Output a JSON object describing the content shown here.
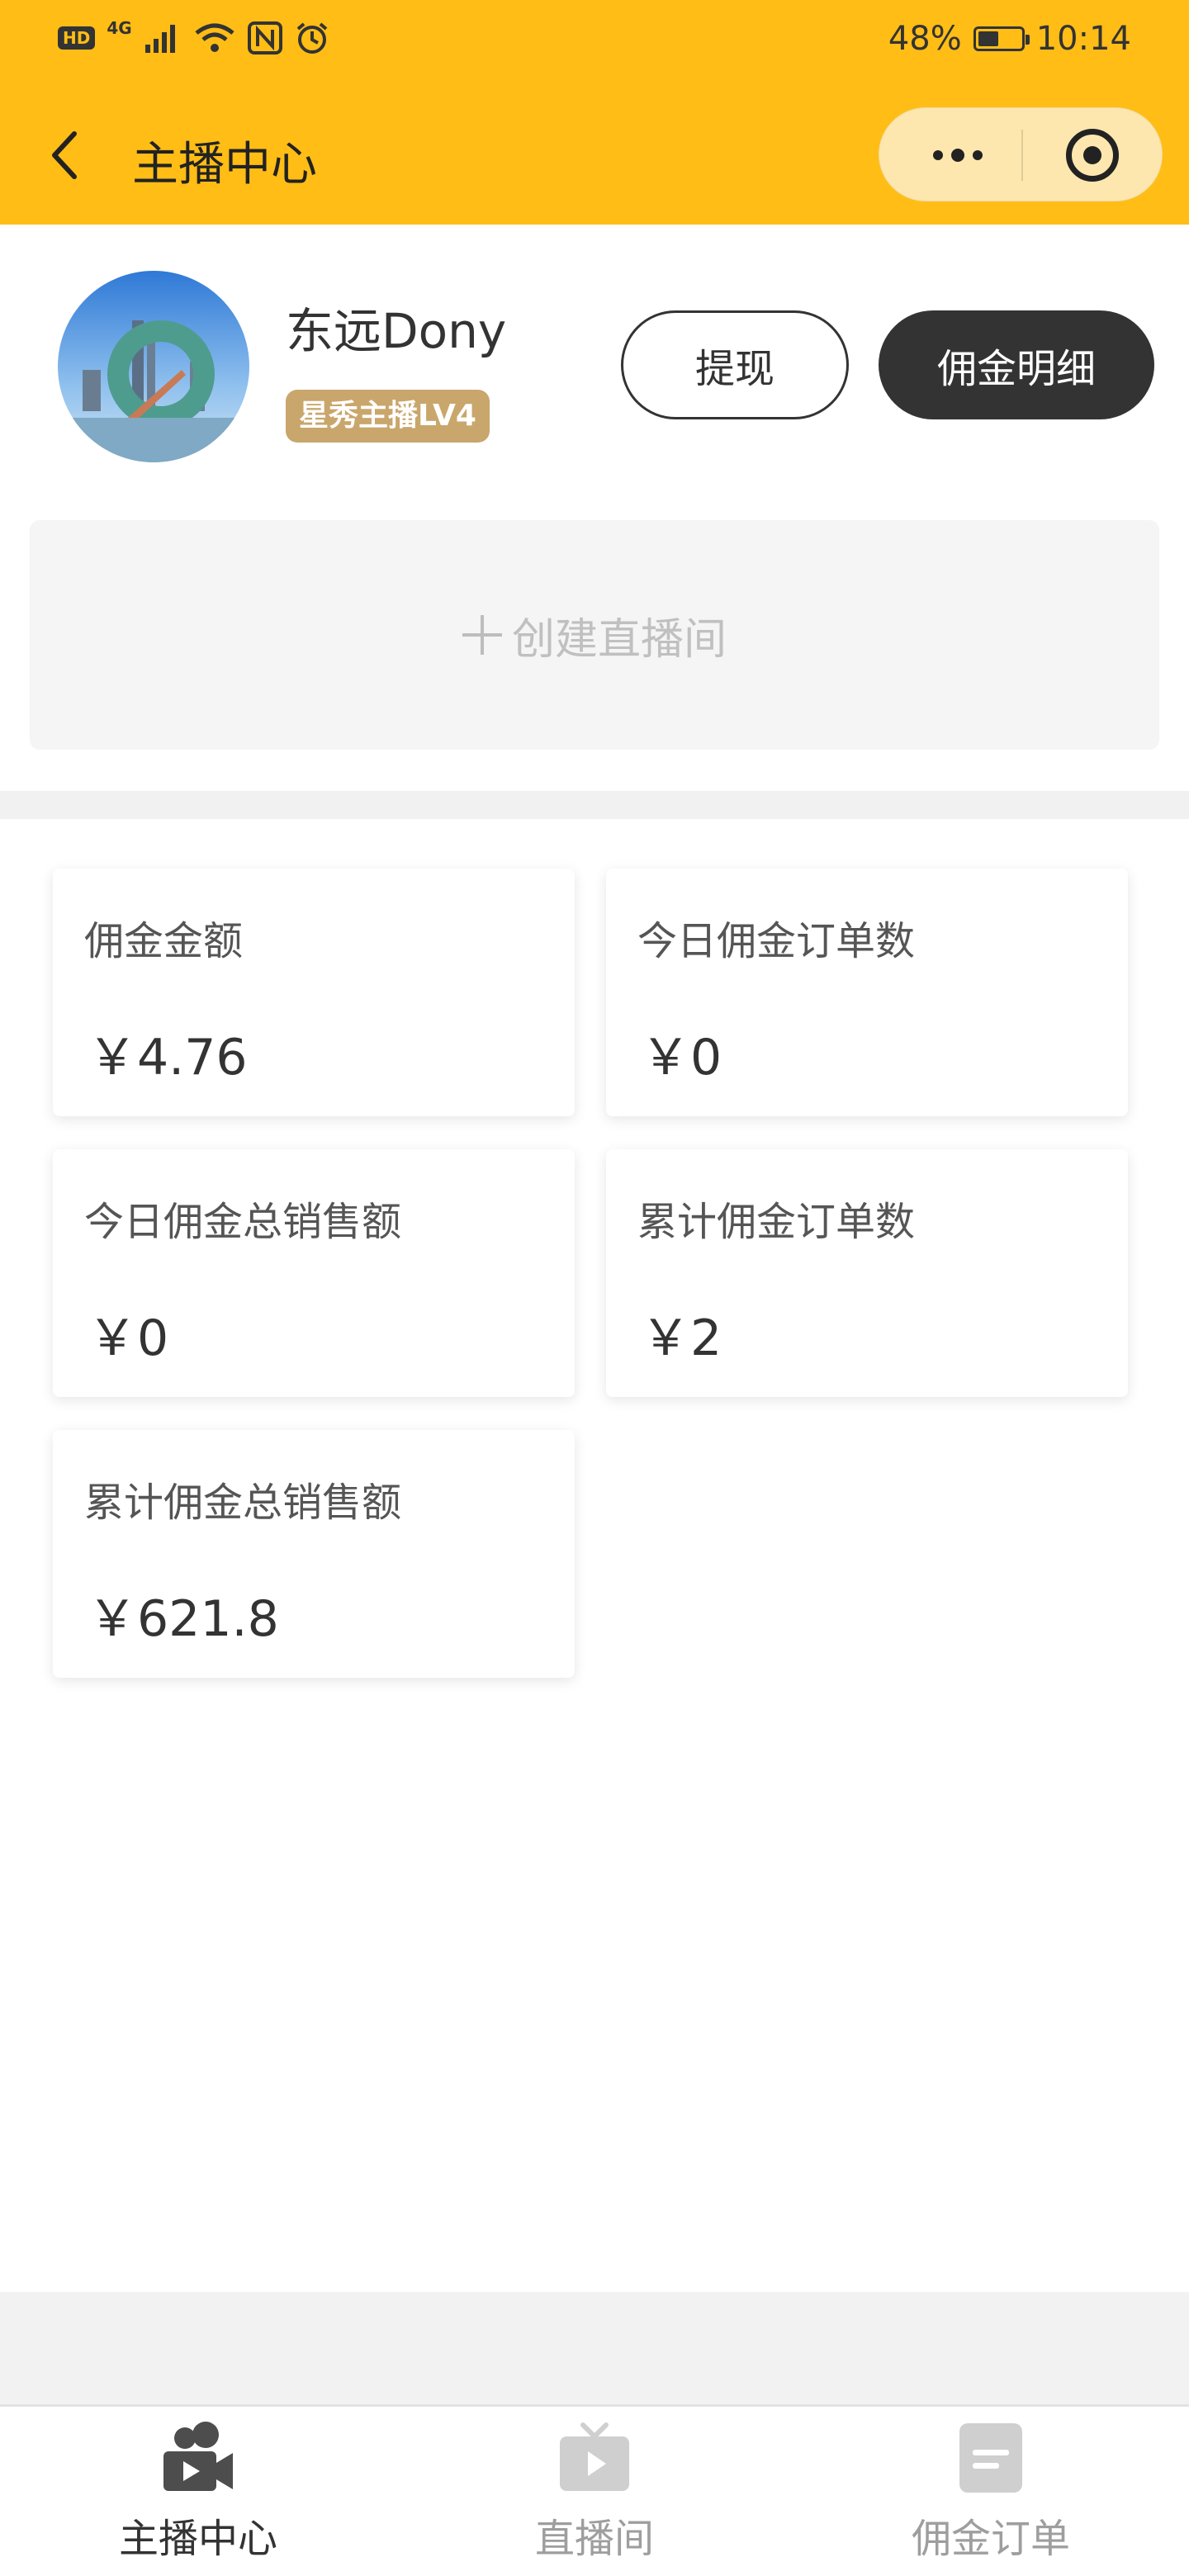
{
  "status_bar": {
    "hd": "HD",
    "network": "4G",
    "battery_percent": "48%",
    "battery_level": 0.48,
    "time": "10:14"
  },
  "nav": {
    "title": "主播中心"
  },
  "profile": {
    "name": "东远Dony",
    "level_badge": "星秀主播LV4",
    "withdraw_label": "提现",
    "commission_detail_label": "佣金明细"
  },
  "create_room": {
    "label": "创建直播间"
  },
  "stats": [
    {
      "label": "佣金金额",
      "value": "￥4.76"
    },
    {
      "label": "今日佣金订单数",
      "value": "￥0"
    },
    {
      "label": "今日佣金总销售额",
      "value": "￥0"
    },
    {
      "label": "累计佣金订单数",
      "value": "￥2"
    },
    {
      "label": "累计佣金总销售额",
      "value": "￥621.8"
    }
  ],
  "tabs": [
    {
      "label": "主播中心",
      "icon": "video-camera-icon",
      "active": true
    },
    {
      "label": "直播间",
      "icon": "tv-play-icon",
      "active": false
    },
    {
      "label": "佣金订单",
      "icon": "order-document-icon",
      "active": false
    }
  ],
  "colors": {
    "brand": "#ffbd16",
    "badge": "#c9a66b",
    "dark_button": "#333333"
  }
}
